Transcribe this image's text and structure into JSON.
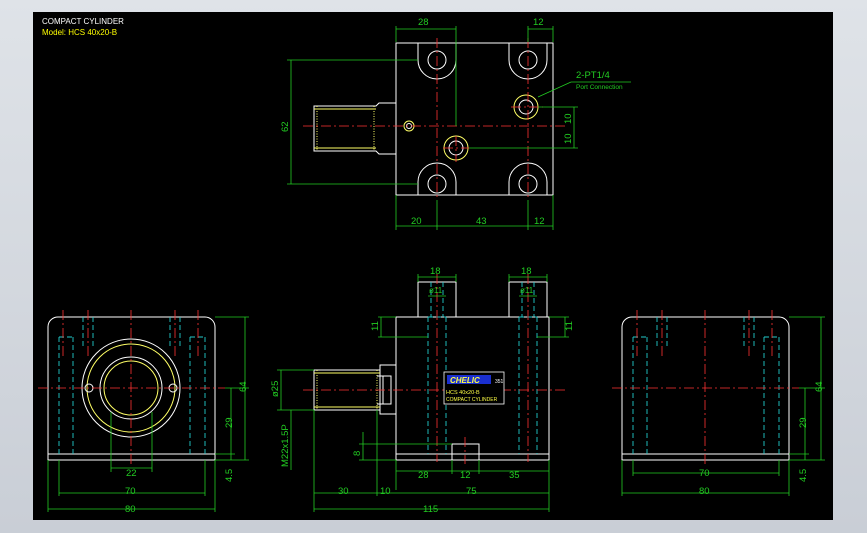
{
  "title_block": {
    "title": "COMPACT CYLINDER",
    "model": "Model: HCS 40x20-B"
  },
  "dimensions": {
    "top_28": "28",
    "top_12": "12",
    "side_62": "62",
    "right_10a": "10",
    "right_10b": "10",
    "bot_20": "20",
    "bot_43": "43",
    "bot_12": "12",
    "port_note": "2-PT1/4",
    "port_sub": "Port Connection",
    "f_18a": "18",
    "f_18b": "18",
    "f_d11a": "ø11",
    "f_d11b": "ø11",
    "f_11a": "11",
    "f_11b": "11",
    "f_d25": "ø25",
    "f_m22": "M22x1.5P",
    "f_8": "8",
    "f_28": "28",
    "f_12": "12",
    "f_35": "35",
    "f_30": "30",
    "f_10": "10",
    "f_75": "75",
    "f_115": "115",
    "l_22": "22",
    "l_70": "70",
    "l_80": "80",
    "l_64": "64",
    "l_29": "29",
    "l_45": "4.5",
    "r_70": "70",
    "r_80": "80",
    "r_64": "64",
    "r_29": "29",
    "r_45": "4.5"
  },
  "nameplate": {
    "brand": "CHELIC",
    "code": "351",
    "model": "HCS 40x20-B",
    "desc": "COMPACT CYLINDER"
  }
}
